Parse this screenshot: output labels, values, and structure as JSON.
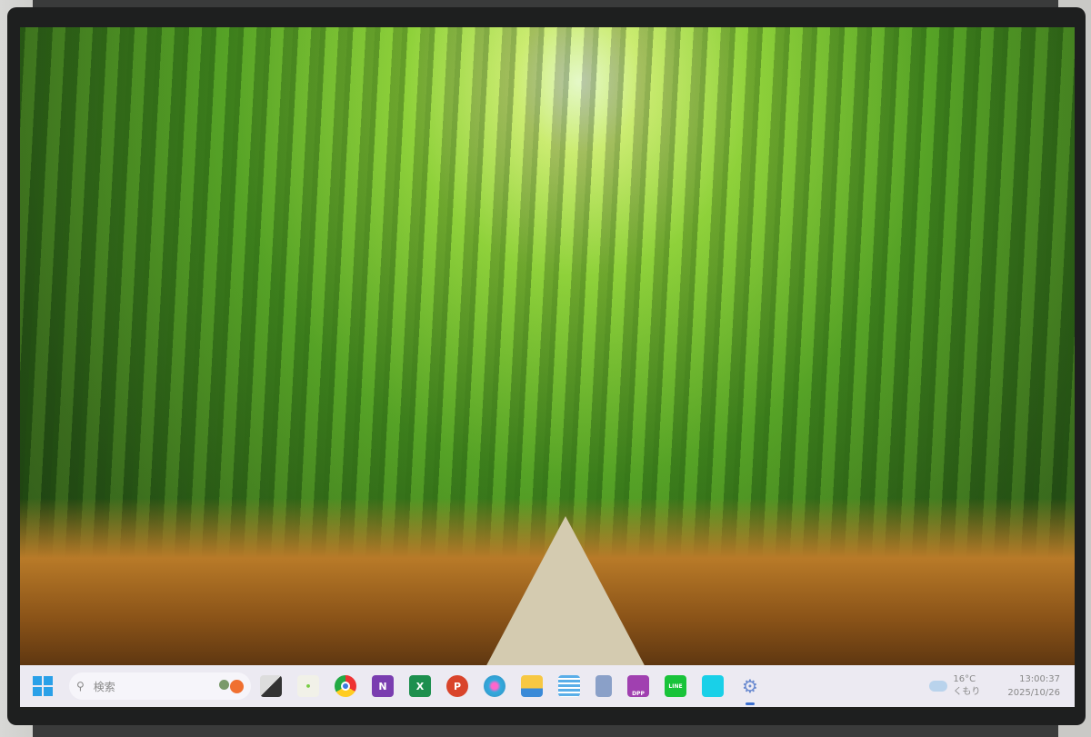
{
  "taskbar": {
    "search_placeholder": "検索",
    "apps": [
      {
        "name": "fruit-widget",
        "label": ""
      },
      {
        "name": "task-view",
        "label": ""
      },
      {
        "name": "widget-app",
        "label": ""
      },
      {
        "name": "chrome",
        "label": ""
      },
      {
        "name": "onenote",
        "label": "N"
      },
      {
        "name": "excel",
        "label": "X"
      },
      {
        "name": "powerpoint",
        "label": "P"
      },
      {
        "name": "paint",
        "label": ""
      },
      {
        "name": "file-explorer",
        "label": ""
      },
      {
        "name": "notepad",
        "label": ""
      },
      {
        "name": "calculator",
        "label": ""
      },
      {
        "name": "dpp-app",
        "label": "DPP"
      },
      {
        "name": "line",
        "label": "LINE"
      },
      {
        "name": "cyan-app",
        "label": ""
      },
      {
        "name": "settings",
        "label": ""
      }
    ],
    "weather": {
      "temp": "16°C",
      "condition": "くもり"
    },
    "clock": {
      "time": "13:00:37",
      "date": "2025/10/26"
    }
  },
  "colors": {
    "accent": "#2aa0e8",
    "taskbar": "#eceaf2"
  }
}
